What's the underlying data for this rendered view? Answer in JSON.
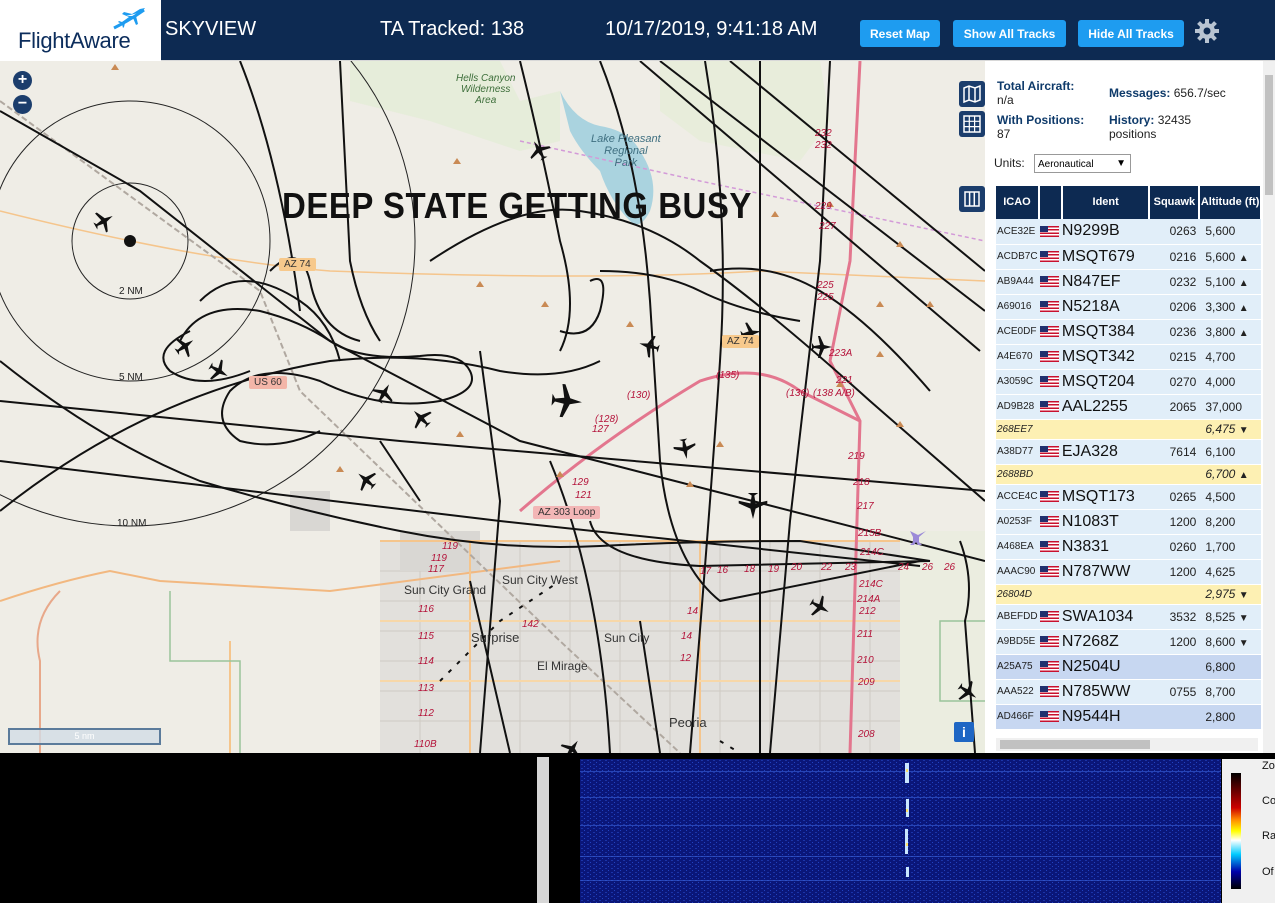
{
  "header": {
    "logo_text": "FlightAware",
    "app_name": "SKYVIEW",
    "tracked_label": "TA Tracked: 138",
    "datetime": "10/17/2019, 9:41:18 AM",
    "buttons": {
      "reset": "Reset Map",
      "show": "Show All Tracks",
      "hide": "Hide All Tracks"
    },
    "brand_color": "#0d2a52",
    "accent_color": "#1e9cf0"
  },
  "map": {
    "overlay_text": "DEEP STATE GETTING BUSY",
    "zoom_in": "+",
    "zoom_out": "−",
    "scale_label": "5 nm",
    "info": "i",
    "rings": [
      "2 NM",
      "5 NM",
      "10 NM"
    ],
    "labels": {
      "hells_canyon": "Hells Canyon\nWilderness\nArea",
      "lake_pleasant": "Lake Pleasant\nRegional\nPark",
      "sun_city_grand": "Sun City Grand",
      "sun_city_west": "Sun City West",
      "surprise": "Surprise",
      "sun_city": "Sun City",
      "el_mirage": "El Mirage",
      "peoria": "Peoria",
      "az74_a": "AZ 74",
      "az74_b": "AZ 74",
      "us60": "US 60",
      "az303": "AZ 303 Loop",
      "r232a": "232",
      "r232b": "232",
      "r229": "229",
      "r227": "227",
      "r225a": "225",
      "r225b": "225",
      "r223a": "223A",
      "r221": "221",
      "r219": "219",
      "r218": "218",
      "r217": "217",
      "r215b": "215B",
      "r214c": "214C",
      "r214c2": "214C",
      "r214a": "214A",
      "r212": "212",
      "r211": "211",
      "r210": "210",
      "r209": "209",
      "r208": "208",
      "r135": "(135)",
      "r130": "(130)",
      "r136": "(136)",
      "r138": "(138 A/B)",
      "r128": "(128)",
      "r127": "127",
      "r129": "129",
      "r121": "121",
      "r119a": "119",
      "r119b": "119",
      "r117": "117",
      "r116": "116",
      "r115": "115",
      "r114": "114",
      "r113": "113",
      "r112": "112",
      "r110b": "110B",
      "r142": "142",
      "r14a": "14",
      "r14b": "14",
      "r12": "12",
      "r17": "17",
      "r16": "16",
      "r18": "18",
      "r19": "19",
      "r20": "20",
      "r22": "22",
      "r23": "23",
      "r24": "24",
      "r26a": "26",
      "r26b": "26"
    }
  },
  "sidebar": {
    "total_aircraft_label": "Total Aircraft:",
    "total_aircraft_value": "n/a",
    "messages_label": "Messages:",
    "messages_value": "656.7/sec",
    "with_positions_label": "With Positions:",
    "with_positions_value": "87",
    "history_label": "History:",
    "history_value": "32435",
    "history_unit": "positions",
    "units_label": "Units:",
    "units_value": "Aeronautical",
    "columns": [
      "ICAO",
      "",
      "Ident",
      "Squawk",
      "Altitude (ft)"
    ],
    "rows": [
      {
        "icao": "ACE32E",
        "ident": "N9299B",
        "squawk": "0263",
        "alt": "5,600",
        "trend": "",
        "style": "norm"
      },
      {
        "icao": "ACDB7C",
        "ident": "MSQT679",
        "squawk": "0216",
        "alt": "5,600",
        "trend": "▲",
        "style": "norm"
      },
      {
        "icao": "AB9A44",
        "ident": "N847EF",
        "squawk": "0232",
        "alt": "5,100",
        "trend": "▲",
        "style": "norm"
      },
      {
        "icao": "A69016",
        "ident": "N5218A",
        "squawk": "0206",
        "alt": "3,300",
        "trend": "▲",
        "style": "norm"
      },
      {
        "icao": "ACE0DF",
        "ident": "MSQT384",
        "squawk": "0236",
        "alt": "3,800",
        "trend": "▲",
        "style": "norm"
      },
      {
        "icao": "A4E670",
        "ident": "MSQT342",
        "squawk": "0215",
        "alt": "4,700",
        "trend": "",
        "style": "norm"
      },
      {
        "icao": "A3059C",
        "ident": "MSQT204",
        "squawk": "0270",
        "alt": "4,000",
        "trend": "",
        "style": "norm"
      },
      {
        "icao": "AD9B28",
        "ident": "AAL2255",
        "squawk": "2065",
        "alt": "37,000",
        "trend": "",
        "style": "norm"
      },
      {
        "icao": "268EE7",
        "ident": "",
        "squawk": "",
        "alt": "6,475",
        "trend": "▼",
        "style": "yel"
      },
      {
        "icao": "A38D77",
        "ident": "EJA328",
        "squawk": "7614",
        "alt": "6,100",
        "trend": "",
        "style": "norm"
      },
      {
        "icao": "2688BD",
        "ident": "",
        "squawk": "",
        "alt": "6,700",
        "trend": "▲",
        "style": "yel"
      },
      {
        "icao": "ACCE4C",
        "ident": "MSQT173",
        "squawk": "0265",
        "alt": "4,500",
        "trend": "",
        "style": "norm"
      },
      {
        "icao": "A0253F",
        "ident": "N1083T",
        "squawk": "1200",
        "alt": "8,200",
        "trend": "",
        "style": "norm"
      },
      {
        "icao": "A468EA",
        "ident": "N3831",
        "squawk": "0260",
        "alt": "1,700",
        "trend": "",
        "style": "norm"
      },
      {
        "icao": "AAAC90",
        "ident": "N787WW",
        "squawk": "1200",
        "alt": "4,625",
        "trend": "",
        "style": "norm"
      },
      {
        "icao": "26804D",
        "ident": "",
        "squawk": "",
        "alt": "2,975",
        "trend": "▼",
        "style": "yel"
      },
      {
        "icao": "ABEFDD",
        "ident": "SWA1034",
        "squawk": "3532",
        "alt": "8,525",
        "trend": "▼",
        "style": "norm"
      },
      {
        "icao": "A9BD5E",
        "ident": "N7268Z",
        "squawk": "1200",
        "alt": "8,600",
        "trend": "▼",
        "style": "norm"
      },
      {
        "icao": "A25A75",
        "ident": "N2504U",
        "squawk": "",
        "alt": "6,800",
        "trend": "",
        "style": "blue"
      },
      {
        "icao": "AAA522",
        "ident": "N785WW",
        "squawk": "0755",
        "alt": "8,700",
        "trend": "",
        "style": "norm"
      },
      {
        "icao": "AD466F",
        "ident": "N9544H",
        "squawk": "",
        "alt": "2,800",
        "trend": "",
        "style": "blue"
      }
    ]
  },
  "waterfall_panel": {
    "labels": [
      "Zo",
      "Con",
      "Ra",
      "Of"
    ]
  }
}
